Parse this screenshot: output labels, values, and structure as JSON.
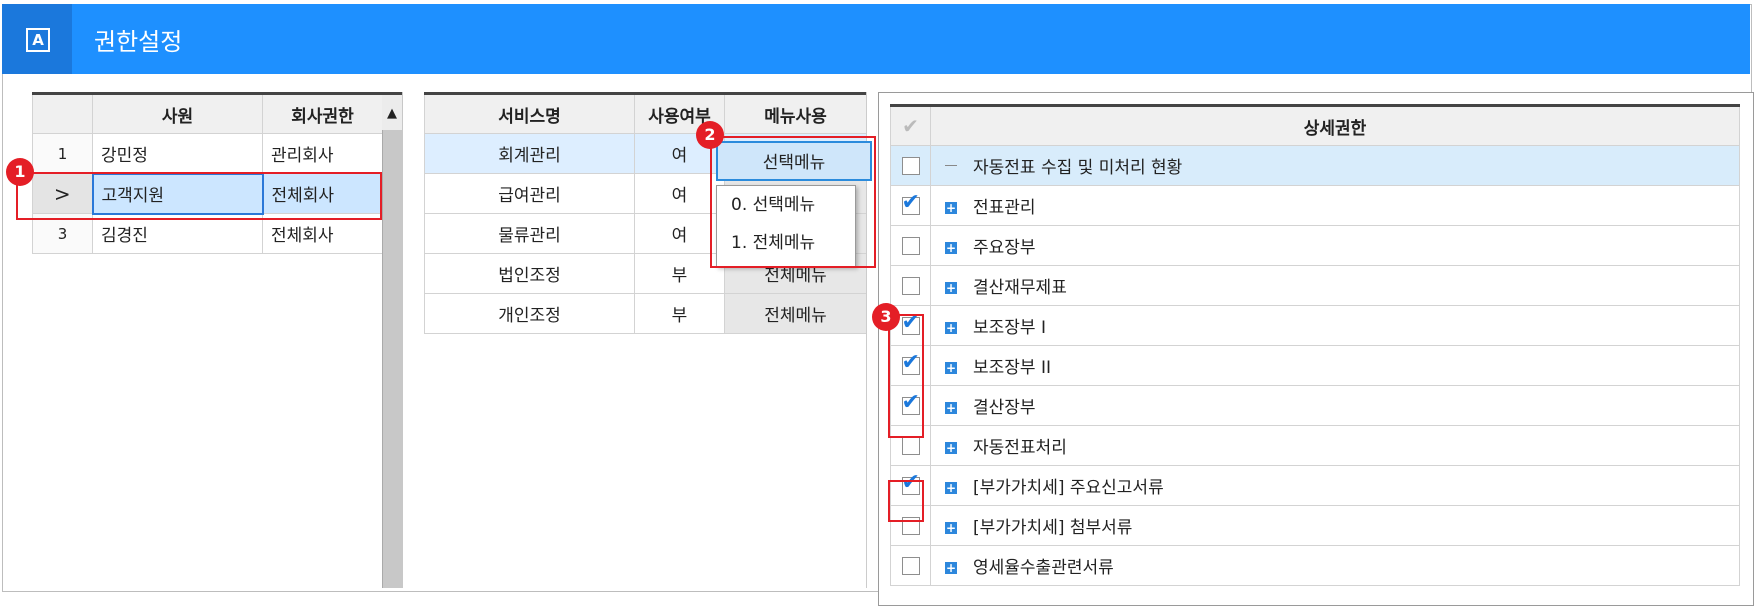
{
  "app": {
    "title": "권한설정",
    "icon_letter": "A"
  },
  "employees": {
    "headers": [
      "사원",
      "회사권한"
    ],
    "rows": [
      {
        "num": "1",
        "name": "강민정",
        "auth": "관리회사"
      },
      {
        "arrow": ">",
        "name": "고객지원",
        "auth": "전체회사"
      },
      {
        "num": "3",
        "name": "김경진",
        "auth": "전체회사"
      }
    ]
  },
  "services": {
    "headers": [
      "서비스명",
      "사용여부",
      "메뉴사용"
    ],
    "rows": [
      {
        "name": "회계관리",
        "use": "여",
        "menu": "선택메뉴"
      },
      {
        "name": "급여관리",
        "use": "여",
        "menu": ""
      },
      {
        "name": "물류관리",
        "use": "여",
        "menu": ""
      },
      {
        "name": "법인조정",
        "use": "부",
        "menu": "전체메뉴"
      },
      {
        "name": "개인조정",
        "use": "부",
        "menu": "전체메뉴"
      }
    ],
    "dropdown_options": [
      "0. 선택메뉴",
      "1. 전체메뉴"
    ]
  },
  "detail": {
    "header": "상세권한",
    "rows": [
      {
        "label": "자동전표 수집 및 미처리 현황",
        "checked": false,
        "expandable": false
      },
      {
        "label": "전표관리",
        "checked": true,
        "expandable": true
      },
      {
        "label": "주요장부",
        "checked": false,
        "expandable": true
      },
      {
        "label": "결산재무제표",
        "checked": false,
        "expandable": true
      },
      {
        "label": "보조장부 I",
        "checked": true,
        "expandable": true
      },
      {
        "label": "보조장부 II",
        "checked": true,
        "expandable": true
      },
      {
        "label": "결산장부",
        "checked": true,
        "expandable": true
      },
      {
        "label": "자동전표처리",
        "checked": false,
        "expandable": true
      },
      {
        "label": "[부가가치세] 주요신고서류",
        "checked": true,
        "expandable": true
      },
      {
        "label": "[부가가치세] 첨부서류",
        "checked": false,
        "expandable": true
      },
      {
        "label": "영세율수출관련서류",
        "checked": false,
        "expandable": true
      }
    ]
  },
  "badges": [
    "1",
    "2",
    "3"
  ],
  "colors": {
    "titlebar": "#1e90ff",
    "accent": "#e41e26",
    "selection": "#cce6ff"
  }
}
